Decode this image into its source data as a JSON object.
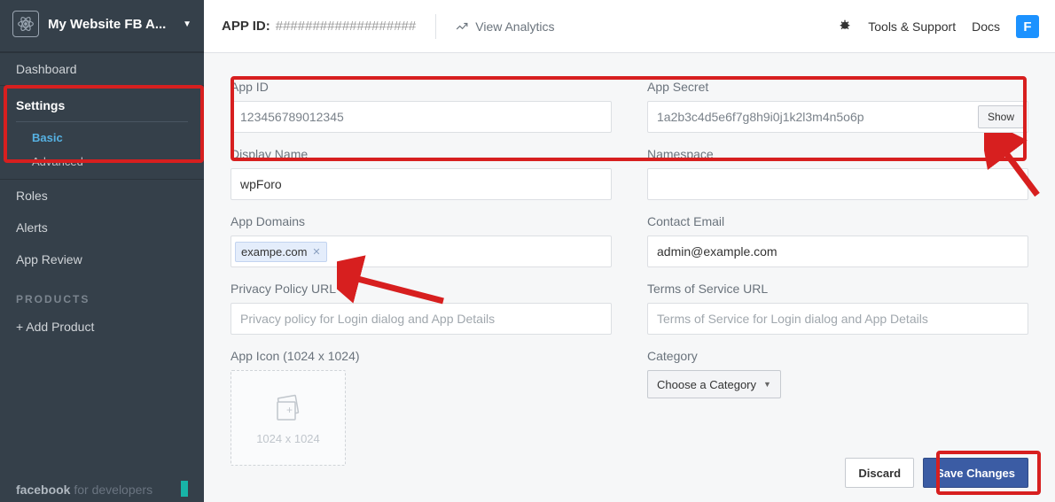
{
  "sidebar": {
    "app_name": "My Website FB A...",
    "items": {
      "dashboard": "Dashboard",
      "settings": "Settings",
      "basic": "Basic",
      "advanced": "Advanced",
      "roles": "Roles",
      "alerts": "Alerts",
      "app_review": "App Review"
    },
    "products_label": "PRODUCTS",
    "add_product": "+ Add Product",
    "footer_brand_fb": "facebook",
    "footer_brand_rest": " for developers"
  },
  "topbar": {
    "appid_label": "APP ID:",
    "appid_value": "###################",
    "view_analytics": "View Analytics",
    "tools_support": "Tools & Support",
    "docs": "Docs",
    "avatar_letter": "F"
  },
  "form": {
    "app_id": {
      "label": "App ID",
      "value": "123456789012345"
    },
    "app_secret": {
      "label": "App Secret",
      "value": "1a2b3c4d5e6f7g8h9i0j1k2l3m4n5o6p",
      "show_btn": "Show"
    },
    "display_name": {
      "label": "Display Name",
      "value": "wpForo"
    },
    "namespace": {
      "label": "Namespace",
      "value": ""
    },
    "app_domains": {
      "label": "App Domains",
      "chip": "exampe.com"
    },
    "contact_email": {
      "label": "Contact Email",
      "value": "admin@example.com"
    },
    "privacy_url": {
      "label": "Privacy Policy URL",
      "placeholder": "Privacy policy for Login dialog and App Details"
    },
    "tos_url": {
      "label": "Terms of Service URL",
      "placeholder": "Terms of Service for Login dialog and App Details"
    },
    "app_icon": {
      "label": "App Icon (1024 x 1024)",
      "hint": "1024 x 1024"
    },
    "category": {
      "label": "Category",
      "selected": "Choose a Category"
    }
  },
  "buttons": {
    "discard": "Discard",
    "save": "Save Changes"
  }
}
